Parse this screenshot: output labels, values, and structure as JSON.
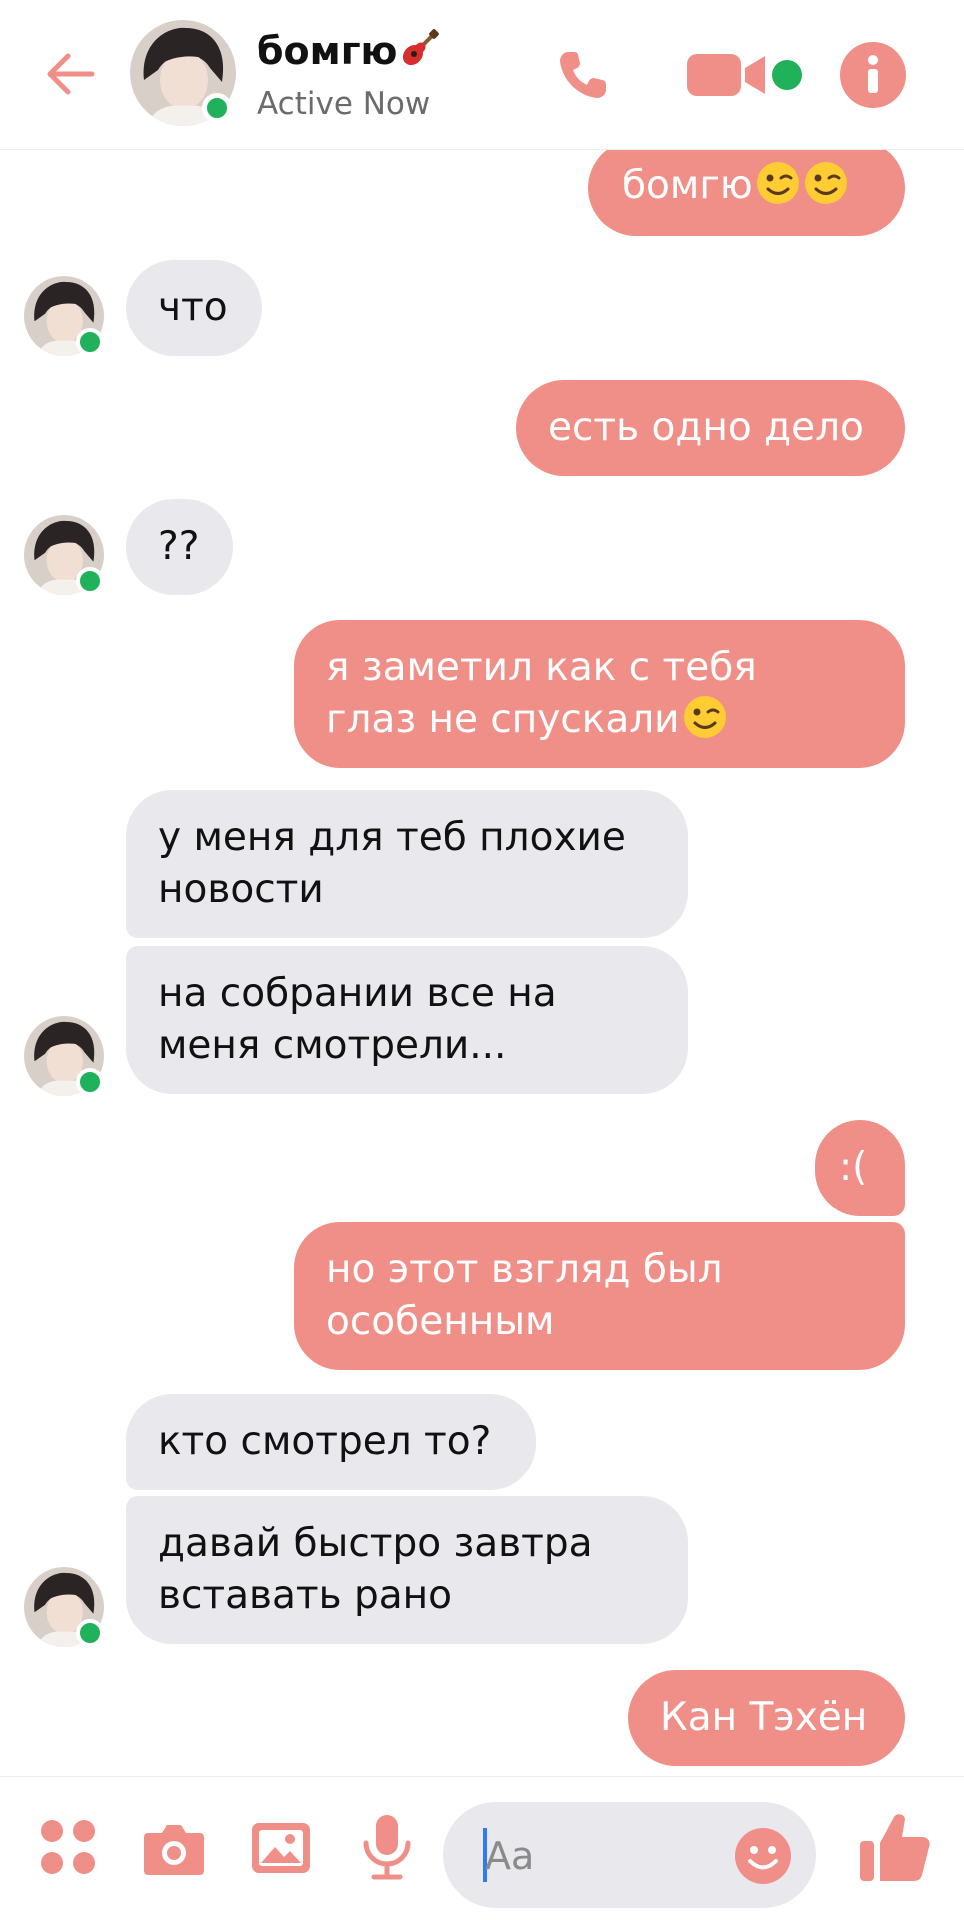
{
  "header": {
    "back_icon": "arrow-left-icon",
    "contact_name": "бомгю",
    "contact_emoji": "guitar",
    "status": "Active Now",
    "accent_color": "#ef8f88",
    "online_color": "#1fb25a"
  },
  "messages": [
    {
      "dir": "out",
      "text": "бомгю",
      "emoji": "winking-face x2"
    },
    {
      "dir": "in",
      "text": "что"
    },
    {
      "dir": "out",
      "text": "есть одно дело"
    },
    {
      "dir": "in",
      "text": "??"
    },
    {
      "dir": "out",
      "lines": [
        "я заметил как с тебя",
        "глаз не спускали"
      ],
      "emoji": "winking-face"
    },
    {
      "dir": "in",
      "lines": [
        "у меня для теб плохие",
        "новости"
      ]
    },
    {
      "dir": "in",
      "lines": [
        "на собрании все на",
        "меня смотрели..."
      ]
    },
    {
      "dir": "out",
      "text": ":("
    },
    {
      "dir": "out",
      "lines": [
        "но этот взгляд был",
        "особенным"
      ]
    },
    {
      "dir": "in",
      "text": "кто смотрел то?"
    },
    {
      "dir": "in",
      "lines": [
        "давай быстро завтра",
        "вставать рано"
      ]
    },
    {
      "dir": "out",
      "text": "Кан Тэхён"
    }
  ],
  "composer": {
    "placeholder": "Aa",
    "icons": [
      "menu-dots-icon",
      "camera-icon",
      "image-icon",
      "microphone-icon",
      "emoji-icon",
      "thumbs-up-icon"
    ]
  }
}
